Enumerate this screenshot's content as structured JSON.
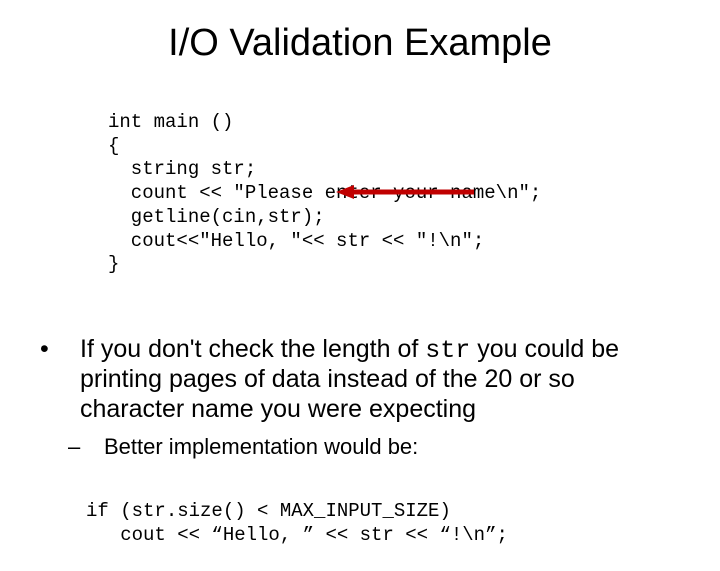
{
  "title": "I/O Validation Example",
  "code1": {
    "l1": "int main ()",
    "l2": "{",
    "l3": "  string str;",
    "l4": "  count << \"Please enter your name\\n\";",
    "l5": "  getline(cin,str);",
    "l6": "  cout<<\"Hello, \"<< str << \"!\\n\";",
    "l7": "}"
  },
  "bullet1_pre": "If you don't check the length of ",
  "bullet1_mono": "str",
  "bullet1_post": " you could be printing pages of data instead of the 20 or so character name you were expecting",
  "bullet2": "Better implementation would be:",
  "code2": {
    "l1": "if (str.size() < MAX_INPUT_SIZE)",
    "l2": "   cout << “Hello, ” << str << “!\\n”;"
  },
  "arrow_color": "#c00000"
}
